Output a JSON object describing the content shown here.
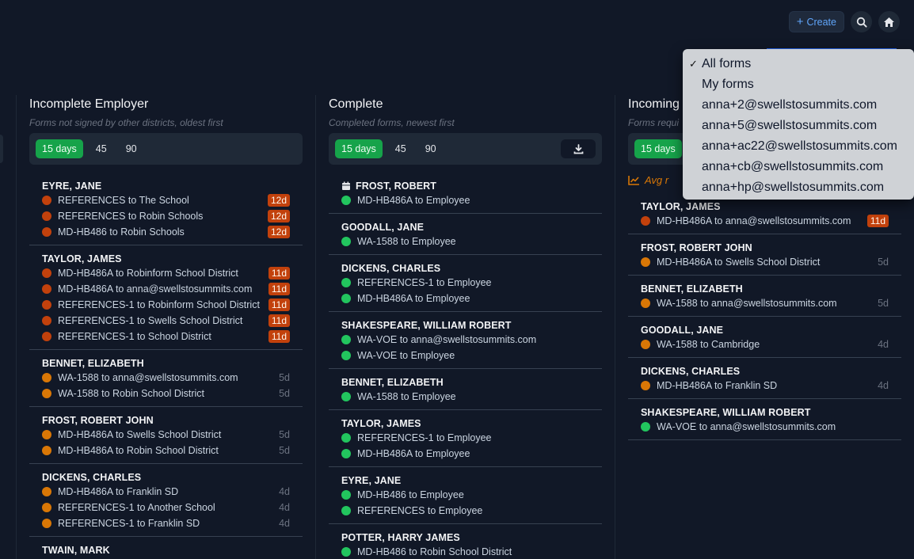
{
  "topbar": {
    "create_label": "Create"
  },
  "columns": [
    {
      "title": "Incomplete Employer",
      "subtitle": "Forms not signed by other districts, oldest first",
      "filters": [
        "15 days",
        "45",
        "90"
      ],
      "groups": [
        {
          "name": "EYRE, JANE",
          "items": [
            {
              "text": "REFERENCES to The School",
              "age": "12d"
            },
            {
              "text": "REFERENCES to Robin Schools",
              "age": "12d"
            },
            {
              "text": "MD-HB486 to Robin Schools",
              "age": "12d"
            }
          ]
        },
        {
          "name": "TAYLOR, JAMES",
          "items": [
            {
              "text": "MD-HB486A to Robinform School District",
              "age": "11d"
            },
            {
              "text": "MD-HB486A to anna@swellstosummits.com",
              "age": "11d"
            },
            {
              "text": "REFERENCES-1 to Robinform School District",
              "age": "11d"
            },
            {
              "text": "REFERENCES-1 to Swells School District",
              "age": "11d"
            },
            {
              "text": "REFERENCES-1 to School District",
              "age": "11d"
            }
          ]
        },
        {
          "name": "BENNET, ELIZABETH",
          "items": [
            {
              "text": "WA-1588 to anna@swellstosummits.com",
              "age": "5d"
            },
            {
              "text": "WA-1588 to Robin School District",
              "age": "5d"
            }
          ]
        },
        {
          "name": "FROST, ROBERT JOHN",
          "items": [
            {
              "text": "MD-HB486A to Swells School District",
              "age": "5d"
            },
            {
              "text": "MD-HB486A to Robin School District",
              "age": "5d"
            }
          ]
        },
        {
          "name": "DICKENS, CHARLES",
          "items": [
            {
              "text": "MD-HB486A to Franklin SD",
              "age": "4d"
            },
            {
              "text": "REFERENCES-1 to Another School",
              "age": "4d"
            },
            {
              "text": "REFERENCES-1 to Franklin SD",
              "age": "4d"
            }
          ]
        },
        {
          "name": "TWAIN, MARK",
          "items": []
        }
      ]
    },
    {
      "title": "Complete",
      "subtitle": "Completed forms, newest first",
      "filters": [
        "15 days",
        "45",
        "90"
      ],
      "groups": [
        {
          "name": "FROST, ROBERT",
          "items": [
            {
              "text": "MD-HB486A to Employee"
            }
          ]
        },
        {
          "name": "GOODALL, JANE",
          "items": [
            {
              "text": "WA-1588 to Employee"
            }
          ]
        },
        {
          "name": "DICKENS, CHARLES",
          "items": [
            {
              "text": "REFERENCES-1 to Employee"
            },
            {
              "text": "MD-HB486A to Employee"
            }
          ]
        },
        {
          "name": "SHAKESPEARE, WILLIAM ROBERT",
          "items": [
            {
              "text": "WA-VOE to anna@swellstosummits.com"
            },
            {
              "text": "WA-VOE to Employee"
            }
          ]
        },
        {
          "name": "BENNET, ELIZABETH",
          "items": [
            {
              "text": "WA-1588 to Employee"
            }
          ]
        },
        {
          "name": "TAYLOR, JAMES",
          "items": [
            {
              "text": "REFERENCES-1 to Employee"
            },
            {
              "text": "MD-HB486A to Employee"
            }
          ]
        },
        {
          "name": "EYRE, JANE",
          "items": [
            {
              "text": "MD-HB486 to Employee"
            },
            {
              "text": "REFERENCES to Employee"
            }
          ]
        },
        {
          "name": "POTTER, HARRY JAMES",
          "items": [
            {
              "text": "MD-HB486 to Robin School District"
            }
          ]
        }
      ]
    },
    {
      "title": "Incoming",
      "subtitle": "Forms requi",
      "filters": [
        "15 days"
      ],
      "avg_label": "Avg r",
      "groups": [
        {
          "name": "TAYLOR, JAMES",
          "items": [
            {
              "text": "MD-HB486A to anna@swellstosummits.com",
              "age": "11d"
            }
          ]
        },
        {
          "name": "FROST, ROBERT JOHN",
          "items": [
            {
              "text": "MD-HB486A to Swells School District",
              "age": "5d"
            }
          ]
        },
        {
          "name": "BENNET, ELIZABETH",
          "items": [
            {
              "text": "WA-1588 to anna@swellstosummits.com",
              "age": "5d"
            }
          ]
        },
        {
          "name": "GOODALL, JANE",
          "items": [
            {
              "text": "WA-1588 to Cambridge",
              "age": "4d"
            }
          ]
        },
        {
          "name": "DICKENS, CHARLES",
          "items": [
            {
              "text": "MD-HB486A to Franklin SD",
              "age": "4d"
            }
          ]
        },
        {
          "name": "SHAKESPEARE, WILLIAM ROBERT",
          "items": [
            {
              "text": "WA-VOE to anna@swellstosummits.com"
            }
          ]
        }
      ]
    }
  ],
  "dropdown": {
    "selected": "All forms",
    "options": [
      "All forms",
      "My forms",
      "anna+2@swellstosummits.com",
      "anna+5@swellstosummits.com",
      "anna+ac22@swellstosummits.com",
      "anna+cb@swellstosummits.com",
      "anna+hp@swellstosummits.com"
    ]
  }
}
